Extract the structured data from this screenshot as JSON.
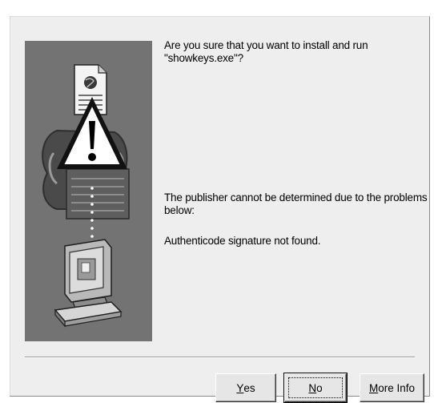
{
  "question": {
    "line1": "Are you sure that you want to install and run",
    "line2": "\"showkeys.exe\"?"
  },
  "publisher": {
    "line1": "The publisher cannot be determined due to the problems",
    "line2": "below:"
  },
  "signature_status": "Authenticode signature not found.",
  "buttons": {
    "yes": {
      "hotkey": "Y",
      "rest": "es"
    },
    "no": {
      "hotkey": "N",
      "rest": "o"
    },
    "more_info": {
      "hotkey": "M",
      "rest": "ore Info"
    }
  },
  "colors": {
    "dialog_background": "#eeeeee",
    "illustration_background": "#737373"
  },
  "icons": [
    "document-icon",
    "warning-icon",
    "certificate-icon",
    "computer-icon"
  ]
}
